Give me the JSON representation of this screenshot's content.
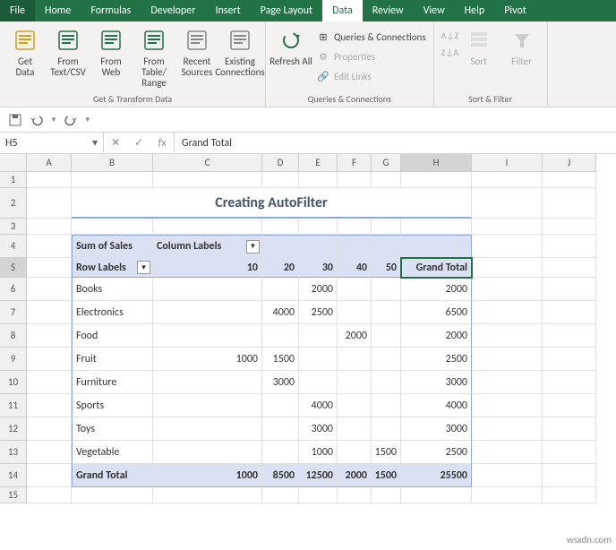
{
  "tabs": [
    "File",
    "Home",
    "Formulas",
    "Developer",
    "Insert",
    "Page Layout",
    "Data",
    "Review",
    "View",
    "Help",
    "Pivot"
  ],
  "activeTab": "Data",
  "ribbon": {
    "g1": {
      "label": "Get & Transform Data",
      "items": [
        "Get\nData",
        "From\nText/CSV",
        "From\nWeb",
        "From Table/\nRange",
        "Recent\nSources",
        "Existing\nConnections"
      ]
    },
    "g2": {
      "label": "Queries & Connections",
      "refresh": "Refresh\nAll",
      "items": [
        "Queries & Connections",
        "Properties",
        "Edit Links"
      ]
    },
    "g3": {
      "label": "Sort & Filter",
      "sort": "Sort",
      "filter": "Filter"
    }
  },
  "nameBox": "H5",
  "formula": "Grand Total",
  "cols": [
    "A",
    "B",
    "C",
    "D",
    "E",
    "F",
    "G",
    "H",
    "I",
    "J"
  ],
  "title": "Creating AutoFilter",
  "pivot": {
    "sumLabel": "Sum of Sales",
    "colLabel": "Column Labels",
    "rowLabel": "Row Labels",
    "colHeaders": [
      "10",
      "20",
      "30",
      "40",
      "50"
    ],
    "grandTotalLabel": "Grand Total",
    "rows": [
      {
        "name": "Books",
        "v": [
          "",
          "",
          "2000",
          "",
          ""
        ],
        "total": "2000"
      },
      {
        "name": "Electronics",
        "v": [
          "",
          "4000",
          "2500",
          "",
          ""
        ],
        "total": "6500"
      },
      {
        "name": "Food",
        "v": [
          "",
          "",
          "",
          "2000",
          ""
        ],
        "total": "2000"
      },
      {
        "name": "Fruit",
        "v": [
          "1000",
          "1500",
          "",
          "",
          ""
        ],
        "total": "2500"
      },
      {
        "name": "Furniture",
        "v": [
          "",
          "3000",
          "",
          "",
          ""
        ],
        "total": "3000"
      },
      {
        "name": "Sports",
        "v": [
          "",
          "",
          "4000",
          "",
          ""
        ],
        "total": "4000"
      },
      {
        "name": "Toys",
        "v": [
          "",
          "",
          "3000",
          "",
          ""
        ],
        "total": "3000"
      },
      {
        "name": "Vegetable",
        "v": [
          "",
          "",
          "1000",
          "",
          "1500"
        ],
        "total": "2500"
      }
    ],
    "grandRow": {
      "name": "Grand Total",
      "v": [
        "1000",
        "8500",
        "12500",
        "2000",
        "1500"
      ],
      "total": "25500"
    }
  },
  "watermark": "wsxdn.com",
  "chart_data": {
    "type": "table",
    "title": "Creating AutoFilter",
    "row_field": "Row Labels",
    "column_field": "Column Labels",
    "columns": [
      10,
      20,
      30,
      40,
      50
    ],
    "rows": [
      "Books",
      "Electronics",
      "Food",
      "Fruit",
      "Furniture",
      "Sports",
      "Toys",
      "Vegetable"
    ],
    "values": [
      [
        null,
        null,
        2000,
        null,
        null
      ],
      [
        null,
        4000,
        2500,
        null,
        null
      ],
      [
        null,
        null,
        null,
        2000,
        null
      ],
      [
        1000,
        1500,
        null,
        null,
        null
      ],
      [
        null,
        3000,
        null,
        null,
        null
      ],
      [
        null,
        null,
        4000,
        null,
        null
      ],
      [
        null,
        null,
        3000,
        null,
        null
      ],
      [
        null,
        null,
        1000,
        null,
        1500
      ]
    ],
    "row_totals": [
      2000,
      6500,
      2000,
      2500,
      3000,
      4000,
      3000,
      2500
    ],
    "column_totals": [
      1000,
      8500,
      12500,
      2000,
      1500
    ],
    "grand_total": 25500
  }
}
